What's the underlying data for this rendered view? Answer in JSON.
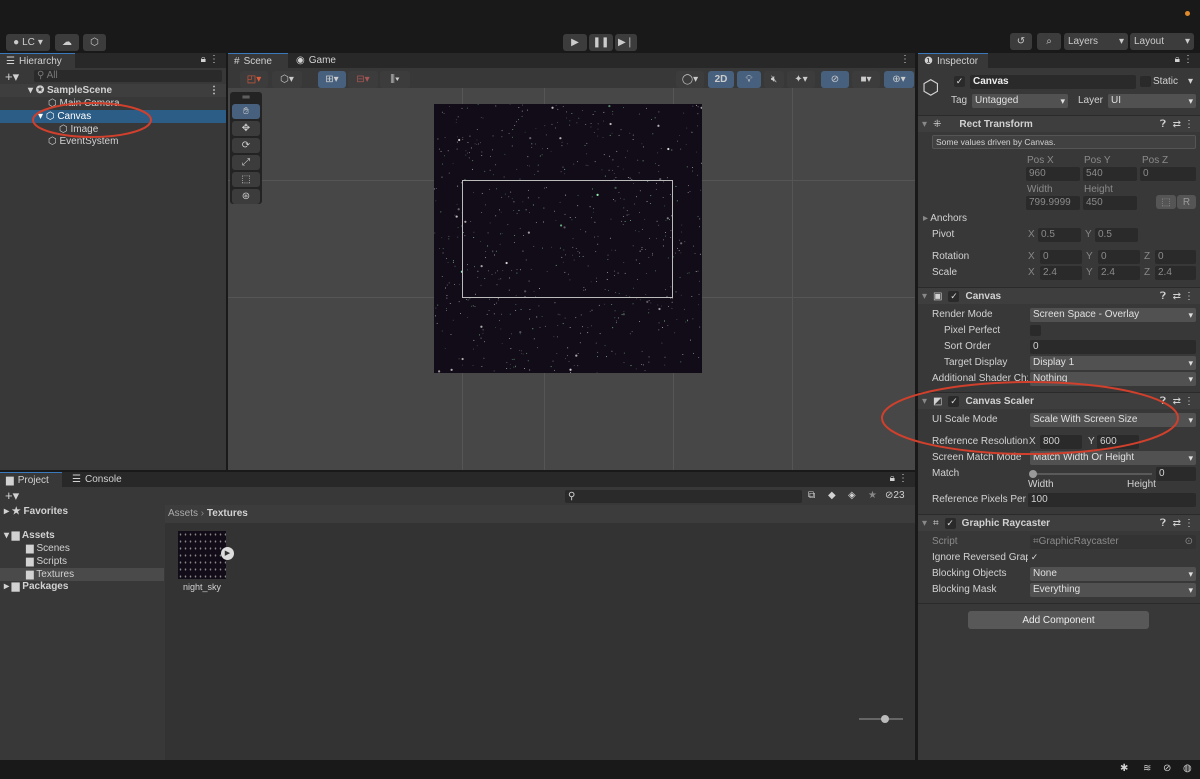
{
  "toolbar": {
    "account": "LC",
    "layers": "Layers",
    "layout": "Layout"
  },
  "hierarchy": {
    "tab": "Hierarchy",
    "search_placeholder": "All",
    "items": [
      "SampleScene",
      "Main Camera",
      "Canvas",
      "Image",
      "EventSystem"
    ]
  },
  "scene": {
    "tabs": [
      "Scene",
      "Game"
    ],
    "mode_2d": "2D"
  },
  "project": {
    "tabs": [
      "Project",
      "Console"
    ],
    "tree": {
      "favorites": "Favorites",
      "assets": "Assets",
      "folders": [
        "Scenes",
        "Scripts",
        "Textures"
      ],
      "packages": "Packages"
    },
    "breadcrumb": [
      "Assets",
      "Textures"
    ],
    "asset": "night_sky",
    "hidden_count": "23"
  },
  "inspector": {
    "tab": "Inspector",
    "object_name": "Canvas",
    "static": "Static",
    "tag_label": "Tag",
    "tag": "Untagged",
    "layer_label": "Layer",
    "layer": "UI",
    "rect": {
      "title": "Rect Transform",
      "info": "Some values driven by Canvas.",
      "posx_l": "Pos X",
      "posy_l": "Pos Y",
      "posz_l": "Pos Z",
      "posx": "960",
      "posy": "540",
      "posz": "0",
      "width_l": "Width",
      "height_l": "Height",
      "width": "799.9999",
      "height": "450",
      "r": "R",
      "anchors": "Anchors",
      "pivot": "Pivot",
      "pivot_x": "0.5",
      "pivot_y": "0.5",
      "rotation": "Rotation",
      "rot": [
        "0",
        "0",
        "0"
      ],
      "scale": "Scale",
      "scl": [
        "2.4",
        "2.4",
        "2.4"
      ],
      "x": "X",
      "y": "Y",
      "z": "Z"
    },
    "canvas": {
      "title": "Canvas",
      "render_mode_l": "Render Mode",
      "render_mode": "Screen Space - Overlay",
      "pixel_perfect_l": "Pixel Perfect",
      "sort_order_l": "Sort Order",
      "sort_order": "0",
      "target_display_l": "Target Display",
      "target_display": "Display 1",
      "shader_l": "Additional Shader Ch:",
      "shader": "Nothing"
    },
    "scaler": {
      "title": "Canvas Scaler",
      "mode_l": "UI Scale Mode",
      "mode": "Scale With Screen Size",
      "ref_res_l": "Reference Resolution",
      "ref_x": "800",
      "ref_y": "600",
      "match_mode_l": "Screen Match Mode",
      "match_mode": "Match Width Or Height",
      "match_l": "Match",
      "match": "0",
      "match_width": "Width",
      "match_height": "Height",
      "ref_ppu_l": "Reference Pixels Per",
      "ref_ppu": "100"
    },
    "raycaster": {
      "title": "Graphic Raycaster",
      "script_l": "Script",
      "script": "GraphicRaycaster",
      "ignore_l": "Ignore Reversed Grap",
      "blocking_objects_l": "Blocking Objects",
      "blocking_objects": "None",
      "blocking_mask_l": "Blocking Mask",
      "blocking_mask": "Everything"
    },
    "add_component": "Add Component"
  },
  "colors": {
    "selection": "#2c5d87",
    "annotation": "#d0402c",
    "accent": "#3a79bb"
  }
}
